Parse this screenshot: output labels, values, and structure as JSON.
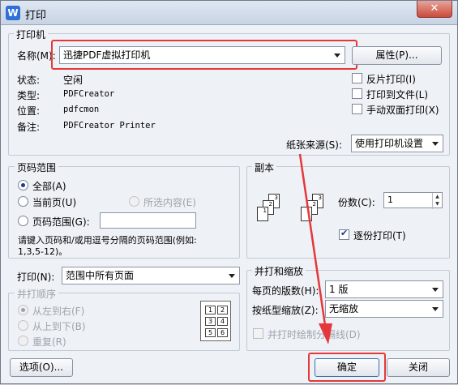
{
  "window": {
    "title": "打印",
    "app_icon": "W",
    "close_glyph": "✕"
  },
  "printer": {
    "group_label": "打印机",
    "name_label": "名称(M):",
    "name_value": "迅捷PDF虚拟打印机",
    "properties_button": "属性(P)...",
    "status_label": "状态:",
    "status_value": "空闲",
    "type_label": "类型:",
    "type_value": "PDFCreator",
    "location_label": "位置:",
    "location_value": "pdfcmon",
    "comment_label": "备注:",
    "comment_value": "PDFCreator Printer",
    "reverse_print": "反片打印(I)",
    "print_to_file": "打印到文件(L)",
    "manual_duplex": "手动双面打印(X)",
    "paper_source_label": "纸张来源(S):",
    "paper_source_value": "使用打印机设置"
  },
  "page_range": {
    "group_label": "页码范围",
    "all": "全部(A)",
    "current": "当前页(U)",
    "selection": "所选内容(E)",
    "range": "页码范围(G):",
    "range_value": "",
    "hint_line1": "请键入页码和/或用逗号分隔的页码范围(例如:",
    "hint_line2": "1,3,5-12)。"
  },
  "copies": {
    "group_label": "副本",
    "count_label": "份数(C):",
    "count_value": "1",
    "collate": "逐份打印(T)",
    "collate_checked": true
  },
  "print_what": {
    "label": "打印(N):",
    "value": "范围中所有页面",
    "order_group": "并打顺序",
    "order_lr": "从左到右(F)",
    "order_tb": "从上到下(B)",
    "repeat": "重复(R)"
  },
  "zoom": {
    "group_label": "并打和缩放",
    "pages_per_sheet_label": "每页的版数(H):",
    "pages_per_sheet_value": "1 版",
    "scale_label": "按纸型缩放(Z):",
    "scale_value": "无缩放",
    "draw_borders": "并打时绘制分隔线(D)"
  },
  "footer": {
    "options": "选项(O)...",
    "ok": "确定",
    "close": "关闭"
  },
  "accent": {
    "highlight": "#e5383a"
  }
}
